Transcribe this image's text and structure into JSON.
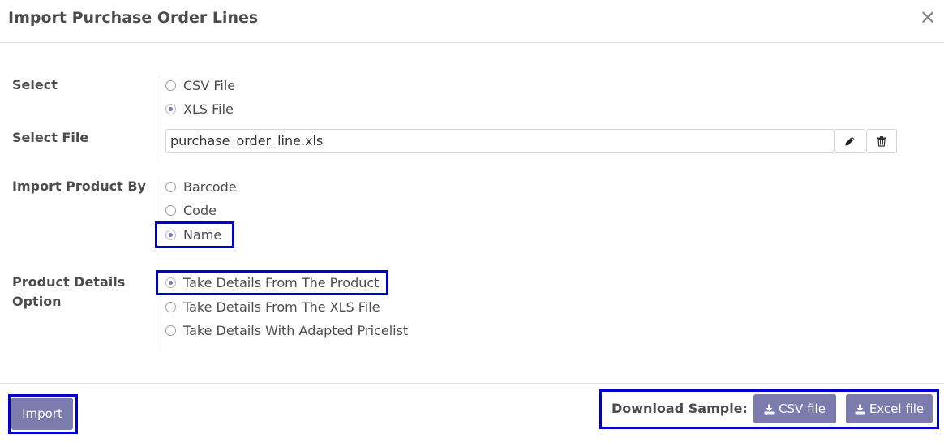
{
  "dialog": {
    "title": "Import Purchase Order Lines",
    "close_glyph": "✕"
  },
  "select": {
    "label": "Select",
    "options": [
      {
        "label": "CSV File",
        "checked": false
      },
      {
        "label": "XLS File",
        "checked": true
      }
    ]
  },
  "select_file": {
    "label": "Select File",
    "value": "purchase_order_line.xls"
  },
  "import_product_by": {
    "label": "Import Product By",
    "options": [
      {
        "label": "Barcode",
        "checked": false
      },
      {
        "label": "Code",
        "checked": false
      },
      {
        "label": "Name",
        "checked": true
      }
    ]
  },
  "product_details": {
    "label_line1": "Product Details",
    "label_line2": "Option",
    "options": [
      {
        "label": "Take Details From The Product",
        "checked": true
      },
      {
        "label": "Take Details From The XLS File",
        "checked": false
      },
      {
        "label": "Take Details With Adapted Pricelist",
        "checked": false
      }
    ]
  },
  "footer": {
    "import_label": "Import",
    "download_label": "Download Sample:",
    "csv_label": "CSV file",
    "excel_label": "Excel file"
  },
  "colors": {
    "primary": "#7c7bad",
    "highlight": "#0000cc",
    "text": "#4c4c4c"
  }
}
